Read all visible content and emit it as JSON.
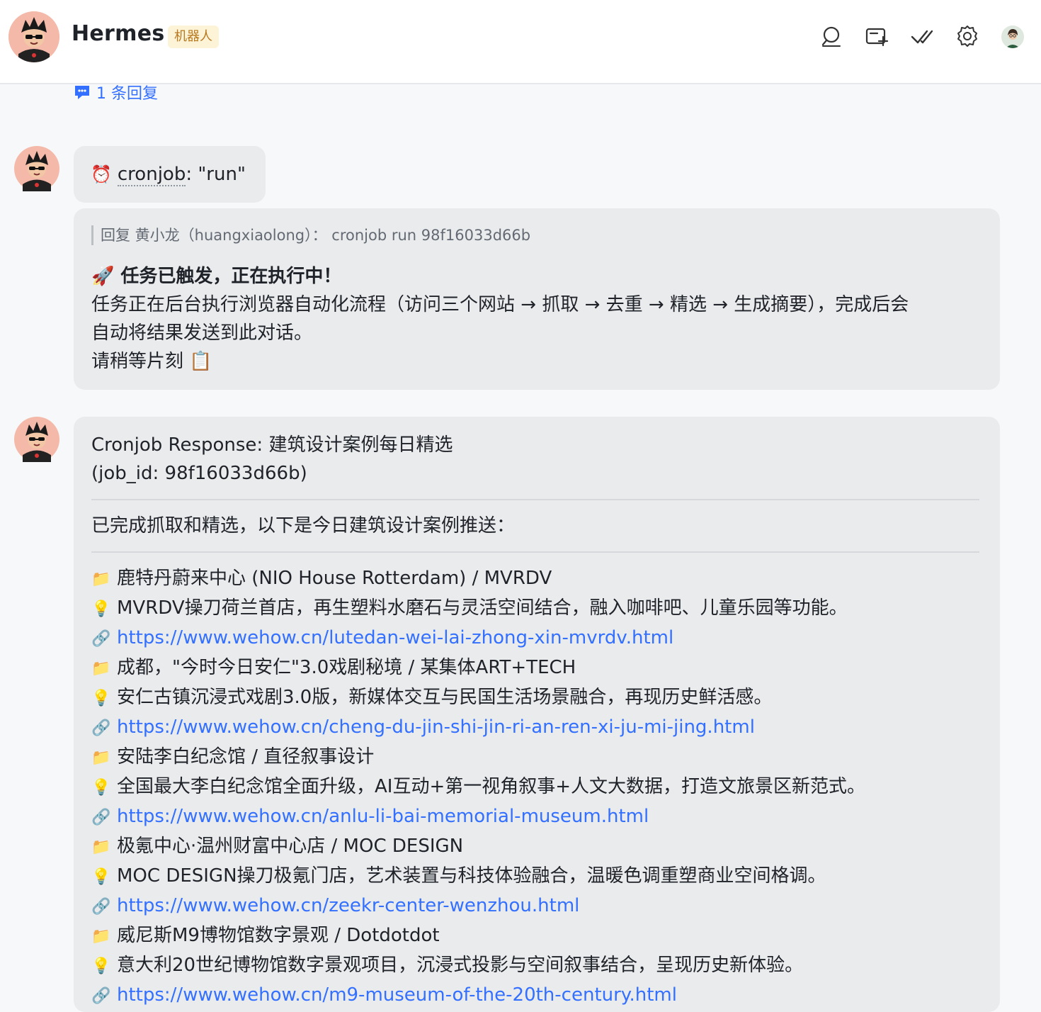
{
  "header": {
    "title": "Hermes",
    "badge": "机器人",
    "icons": [
      "search-icon",
      "new-topic-icon",
      "check-all-icon",
      "settings-icon"
    ]
  },
  "reply_link": {
    "label": "1 条回复"
  },
  "messages": {
    "cron_cmd": {
      "icon": "⏰",
      "keyword": "cronjob",
      "rest": ": \"run\""
    },
    "ack": {
      "quote": "回复 黄小龙（huangxiaolong）： cronjob run 98f16033d66b",
      "title": "🚀 任务已触发，正在执行中！",
      "body1": "任务正在后台执行浏览器自动化流程（访问三个网站 → 抓取 → 去重 → 精选 → 生成摘要），完成后会",
      "body2": "自动将结果发送到此对话。",
      "body3": "请稍等片刻 📋"
    },
    "response": {
      "title": "Cronjob Response: 建筑设计案例每日精选",
      "job_id": "(job_id: 98f16033d66b)",
      "intro": "已完成抓取和精选，以下是今日建筑设计案例推送：",
      "items": [
        {
          "title": "鹿特丹蔚来中心 (NIO House Rotterdam) / MVRDV",
          "desc": "MVRDV操刀荷兰首店，再生塑料水磨石与灵活空间结合，融入咖啡吧、儿童乐园等功能。",
          "url": "https://www.wehow.cn/lutedan-wei-lai-zhong-xin-mvrdv.html"
        },
        {
          "title": "成都，\"今时今日安仁\"3.0戏剧秘境 / 某集体ART+TECH",
          "desc": "安仁古镇沉浸式戏剧3.0版，新媒体交互与民国生活场景融合，再现历史鲜活感。",
          "url": "https://www.wehow.cn/cheng-du-jin-shi-jin-ri-an-ren-xi-ju-mi-jing.html"
        },
        {
          "title": "安陆李白纪念馆 / 直径叙事设计",
          "desc": "全国最大李白纪念馆全面升级，AI互动+第一视角叙事+人文大数据，打造文旅景区新范式。",
          "url": "https://www.wehow.cn/anlu-li-bai-memorial-museum.html"
        },
        {
          "title": "极氪中心·温州财富中心店 / MOC DESIGN",
          "desc": "MOC DESIGN操刀极氪门店，艺术装置与科技体验融合，温暖色调重塑商业空间格调。",
          "url": "https://www.wehow.cn/zeekr-center-wenzhou.html"
        },
        {
          "title": "威尼斯M9博物馆数字景观 / Dotdotdot",
          "desc": "意大利20世纪博物馆数字景观项目，沉浸式投影与空间叙事结合，呈现历史新体验。",
          "url": "https://www.wehow.cn/m9-museum-of-the-20th-century.html"
        }
      ]
    }
  }
}
